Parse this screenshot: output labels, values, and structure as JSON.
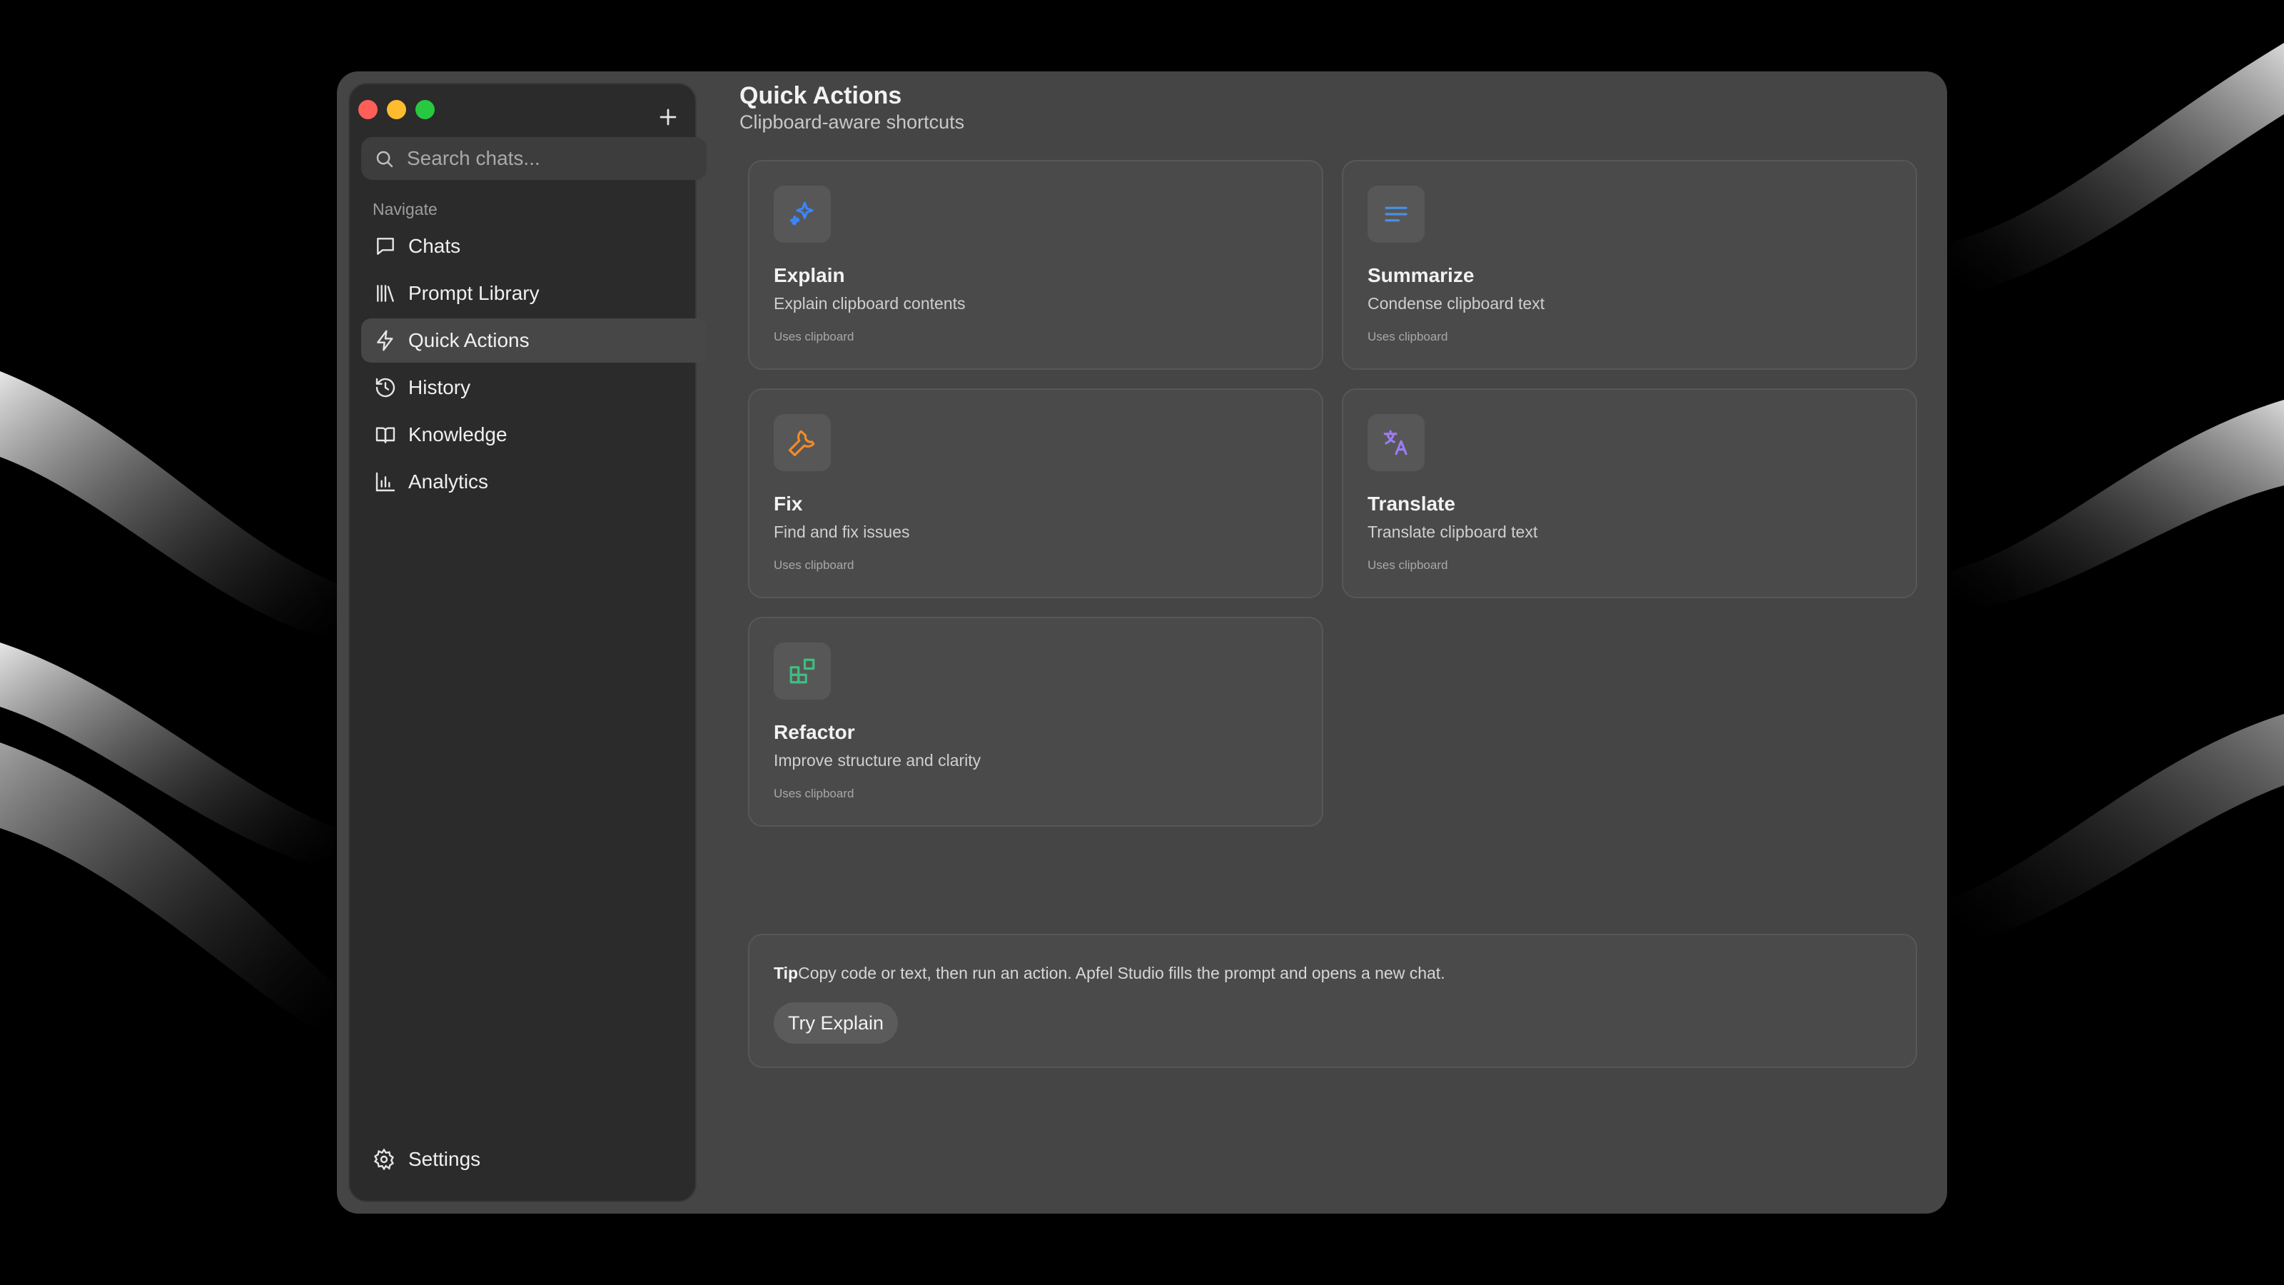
{
  "colors": {
    "window_bg": "#454545",
    "sidebar_bg": "#2b2b2b",
    "card_bg": "#4a4a4a",
    "close": "#ff5f57",
    "minimize": "#febc2e",
    "maximize": "#28c840",
    "explain_icon": "#3a86ff",
    "summarize_icon": "#4a90e2",
    "fix_icon": "#f28c28",
    "translate_icon": "#9b7df0",
    "refactor_icon": "#3fbf7f"
  },
  "sidebar": {
    "search": {
      "placeholder": "Search chats...",
      "value": ""
    },
    "nav_heading": "Navigate",
    "items": [
      {
        "label": "Chats",
        "icon": "chat-bubble-icon",
        "active": false
      },
      {
        "label": "Prompt Library",
        "icon": "library-icon",
        "active": false
      },
      {
        "label": "Quick Actions",
        "icon": "bolt-icon",
        "active": true
      },
      {
        "label": "History",
        "icon": "history-icon",
        "active": false
      },
      {
        "label": "Knowledge",
        "icon": "book-icon",
        "active": false
      },
      {
        "label": "Analytics",
        "icon": "bar-chart-icon",
        "active": false
      }
    ],
    "settings_label": "Settings"
  },
  "main": {
    "title": "Quick Actions",
    "subtitle": "Clipboard-aware shortcuts",
    "actions": [
      {
        "title": "Explain",
        "description": "Explain clipboard contents",
        "note": "Uses clipboard",
        "icon": "sparkles-icon"
      },
      {
        "title": "Summarize",
        "description": "Condense clipboard text",
        "note": "Uses clipboard",
        "icon": "text-lines-icon"
      },
      {
        "title": "Fix",
        "description": "Find and fix issues",
        "note": "Uses clipboard",
        "icon": "wrench-icon"
      },
      {
        "title": "Translate",
        "description": "Translate clipboard text",
        "note": "Uses clipboard",
        "icon": "translate-icon"
      },
      {
        "title": "Refactor",
        "description": "Improve structure and clarity",
        "note": "Uses clipboard",
        "icon": "blocks-icon"
      }
    ],
    "tip": {
      "label": "Tip",
      "text": "Copy code or text, then run an action. Apfel Studio fills the prompt and opens a new chat.",
      "button_label": "Try Explain"
    }
  }
}
